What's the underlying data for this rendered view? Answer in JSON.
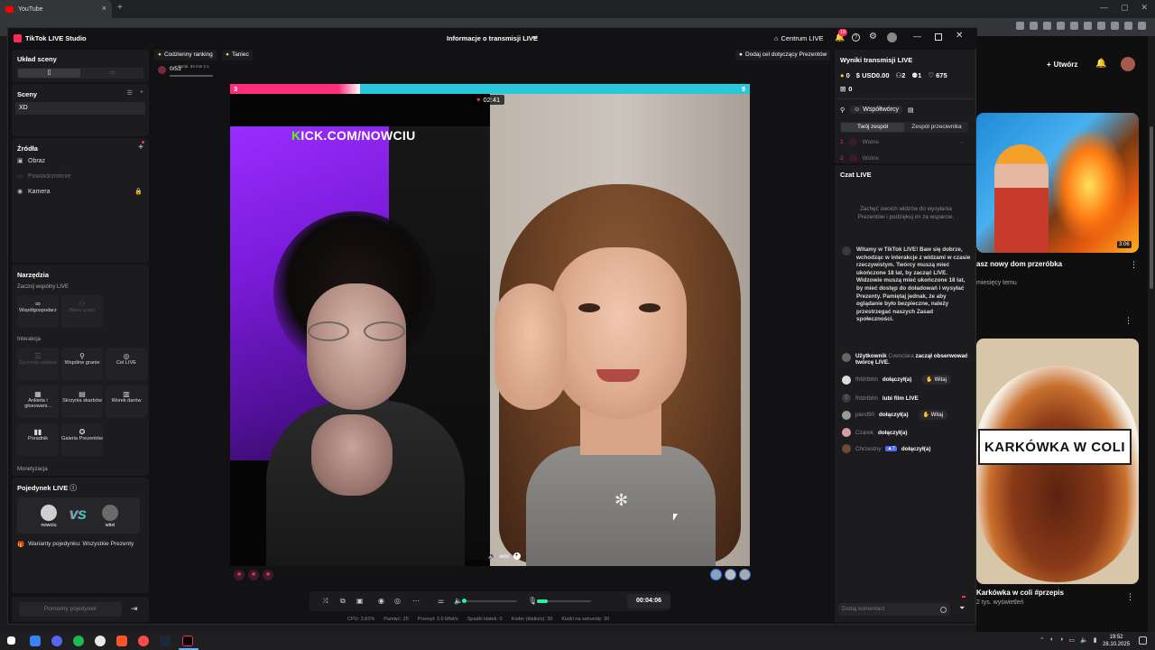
{
  "browser": {
    "tab_title": "YouTube",
    "tab_close": "×",
    "new_tab": "+",
    "window_buttons": [
      "—",
      "▢",
      "✕"
    ]
  },
  "youtube": {
    "create_label": "Utwórz",
    "video1": {
      "duration": "3:06",
      "title": "asz nowy dom przeróbka",
      "meta": "miesięcy temu"
    },
    "video2": {
      "thumb_text": "KARKÓWKA W COLI",
      "title": "Karkówka w coli #przepis",
      "meta": "2 tys. wyświetleń"
    }
  },
  "app": {
    "title": "TikTok LIVE Studio",
    "center_title": "Informacje o transmisji LIVE",
    "live_center": "Centrum LIVE",
    "notif_count": "18"
  },
  "left": {
    "scene_layout": {
      "title": "Układ sceny",
      "opt_portrait": "▯",
      "opt_landscape": "▭"
    },
    "scenes": {
      "title": "Sceny",
      "item": "XD"
    },
    "sources": {
      "title": "Źródła",
      "items": [
        {
          "label": "Obraz",
          "dim": false
        },
        {
          "label": "Powiadomienie",
          "dim": true
        },
        {
          "label": "Kamera",
          "dim": false
        }
      ]
    },
    "tools": {
      "title": "Narzędzia",
      "sub_live": "Zacznij wspólny LIVE",
      "cohost": "Współgospodarz",
      "multi_guest": "Wielu gości",
      "sub_interaction": "Interakcja",
      "t_req": "Życzenia widzów",
      "t_play": "Wspólne granie",
      "t_goal": "Cel LIVE",
      "t_poll": "Ankieta i głosowani...",
      "t_chest": "Skrzynia skarbów",
      "t_bag": "Worek darów",
      "t_guide": "Poradnik",
      "t_gallery": "Galeria Prezentów",
      "sub_monet": "Monetyzacja"
    },
    "duel": {
      "title": "Pojedynek LIVE",
      "p1": "nowciu",
      "p2": "wiixi",
      "vs": "VS",
      "variants": "Warianty pojedynku: Wszystkie Prezenty"
    },
    "rematch": "Ponowny pojedynek"
  },
  "stage": {
    "daily_ranking": "Codzienny ranking",
    "dance": "Taniec",
    "goal": "Dodaj cel dotyczący Prezentów",
    "ranking_count": "0/53",
    "ranking_timer": "Zamk. 34 min 2 s",
    "score_left": "3",
    "score_right": "9",
    "red_fraction": 0.25,
    "battle_timer": "02:41",
    "kick_k": "K",
    "kick_rest": "ICK.COM/NOWCIU",
    "guest_name": "wixi",
    "timer": "00:04:06",
    "stats": [
      "CPU: 3.81%",
      "Pamięć: 25",
      "Przesył: 3.0 Mbit/s",
      "Spadki klatek: 0",
      "Koder (klatki/s): 30",
      "Klatki na sekundę: 30"
    ]
  },
  "right": {
    "results_title": "Wyniki transmisji LIVE",
    "coins": "0",
    "usd": "USD0.00",
    "viewers": "2",
    "follows": "1",
    "likes": "675",
    "gifts": "0",
    "creators": "Współtwórcy",
    "team_mine": "Twój zespół",
    "team_opp": "Zespół przeciwnika",
    "slot1_n": "1",
    "slot1": "Wolne",
    "slot1_dash": "-",
    "slot2_n": "2",
    "slot2": "Wolne",
    "chat_title": "Czat LIVE",
    "chat_hint": "Zachęć swoich widzów do wysyłania Prezentów i podziękuj im za wsparcie.",
    "welcome": "Witamy w TikTok LIVE! Baw się dobrze, wchodząc w interakcje z widzami w czasie rzeczywistym. Twórcy muszą mieć ukończone 18 lat, by zacząć LIVE. Widzowie muszą mieć ukończone 18 lat, by mieć dostęp do doładowań i wysyłać Prezenty. Pamiętaj jednak, że aby oglądanie było bezpieczne, należy przestrzegać naszych Zasad społeczności.",
    "m1_pre": "Użytkownik",
    "m1_user": "Cvenclara",
    "m1_text": "zaczął obserwować twórcę LIVE.",
    "m2_user": "fhfdrtbhh",
    "m2_text": "dołączył(a)",
    "welcome_btn": "Witaj",
    "m3_user": "fhfdrtbhh",
    "m3_text": "lubi film LIVE",
    "m4_user": "pierd90",
    "m4_text": "dołączył(a)",
    "m5_user": "Czarek",
    "m5_text": "dołączył(a)",
    "m6_user": "Chrzestny",
    "m6_lvl": "7",
    "m6_text": "dołączył(a)",
    "input_placeholder": "Dodaj komentarz"
  },
  "taskbar": {
    "time": "19:52",
    "date": "28.10.2025"
  }
}
